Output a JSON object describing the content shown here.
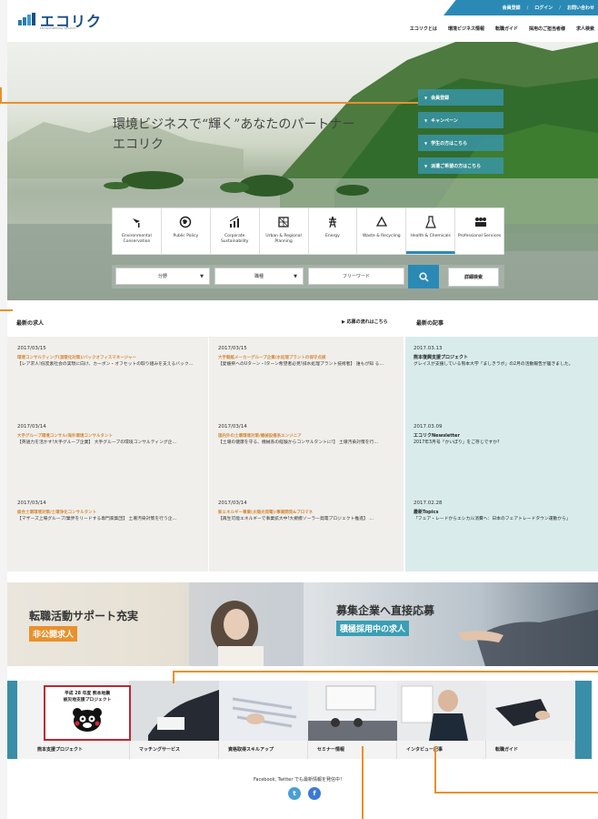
{
  "header": {
    "logo_text": "エコリク",
    "logo_sub": "ENVIRONMENTAL RECRUIT",
    "top_links": [
      "会員登録",
      "ログイン",
      "お問い合わせ"
    ],
    "nav": [
      "エコリクとは",
      "環境ビジネス情報",
      "転職ガイド",
      "採用のご担当者様",
      "求人検索"
    ]
  },
  "hero": {
    "tagline_1": "環境ビジネスで“輝く”あなたのパートナー",
    "tagline_2": "エコリク",
    "side_menu": [
      "会員登録",
      "キャンペーン",
      "学生の方はこちら",
      "派遣ご希望の方はこちら"
    ],
    "categories": [
      {
        "label": "Environmental Conservation",
        "icon": "tree-icon"
      },
      {
        "label": "Public Policy",
        "icon": "globe-icon"
      },
      {
        "label": "Corporate Sustainability",
        "icon": "chart-icon"
      },
      {
        "label": "Urban & Regional Planning",
        "icon": "map-icon"
      },
      {
        "label": "Energy",
        "icon": "tower-icon"
      },
      {
        "label": "Waste & Recycling",
        "icon": "recycle-icon"
      },
      {
        "label": "Health & Chemicals",
        "icon": "flask-icon"
      },
      {
        "label": "Professional Services",
        "icon": "people-icon"
      }
    ],
    "search": {
      "field1": "分野",
      "field2": "職種",
      "keyword_placeholder": "フリーワード",
      "advanced": "詳細検索"
    }
  },
  "listings": {
    "title": "最新の求人",
    "link": "応募の流れはこちら",
    "news_title": "最新の記事",
    "jobs_col1": [
      {
        "date": "2017/03/15",
        "title": "環境コンサルティング(温暖化対策)/バックオフィスマネージャー",
        "text": "【レア求人!低炭素社会の実現に向け、カーボン・オフセットの取り組みを支えるバック…"
      },
      {
        "date": "2017/03/14",
        "title": "大手グループ環境コンサル/海外環境コンサルタント",
        "text": "【英語力を活かす!大手グループ企業】 大手グループの環境コンサルティング企…"
      },
      {
        "date": "2017/03/14",
        "title": "総合土壌環境対策/土壌浄化コンサルタント",
        "text": "【マザーズ上場グループ/業界をリードする専門家集団】 土壌汚染対策を行う企…"
      }
    ],
    "jobs_col2": [
      {
        "date": "2017/03/15",
        "title": "大手製紙メーカーグループ企業/水処理プラントの保守点検",
        "text": "【愛媛県へのUターン・Iターン希望者必見!排水処理プラント技術者】 誰もが知 る…"
      },
      {
        "date": "2017/03/14",
        "title": "国内外の土壌環境対策/機械設備系エンジニア",
        "text": "【土壌の健康を守る、機械系の経験からコンサルタントに!】 土壌汚染対策を行…"
      },
      {
        "date": "2017/03/14",
        "title": "新エネルギー事業(太陽光発電)/事業開発&プロマネ",
        "text": "【再生可能エネルギーで事業拡大中!大規模ソーラー発電プロジェクト推進】 …"
      }
    ],
    "news": [
      {
        "date": "2017.03.13",
        "title": "熊本復興支援プロジェクト",
        "text": "グレイスが支援している熊本大学「ましきラボ」の2月の活動報告が届きました。"
      },
      {
        "date": "2017.03.09",
        "title": "エコリクNewsletter",
        "text": "2017年3月号「かいぽり」をご存じですか?"
      },
      {
        "date": "2017.02.28",
        "title": "最新Topics",
        "text": "「フェア・レードからエシカル消費へ：日本のフェアトレードタウン運動から」"
      }
    ]
  },
  "banners": {
    "left_heading": "転職活動サポート充実",
    "left_tag": "非公開求人",
    "right_heading": "募集企業へ直接応募",
    "right_tag": "積極採用中の求人"
  },
  "tiles": {
    "kuma_line1": "平成 28 年度 熊本地震",
    "kuma_line2": "被災地支援プロジェクト",
    "captions": [
      "熊本支援プロジェクト",
      "マッチングサービス",
      "資格取得スキルアップ",
      "セミナー情報",
      "インタビュー記事",
      "転職ガイド"
    ]
  },
  "footer": {
    "social_text": "Facebook, Twitter でも最新情報を発信中！",
    "twitter_color": "#4a9fd6",
    "facebook_color": "#3a7bd5"
  },
  "colors": {
    "brand": "#2b8ab5",
    "accent": "#e8912c",
    "job_title": "#d58c3c"
  }
}
